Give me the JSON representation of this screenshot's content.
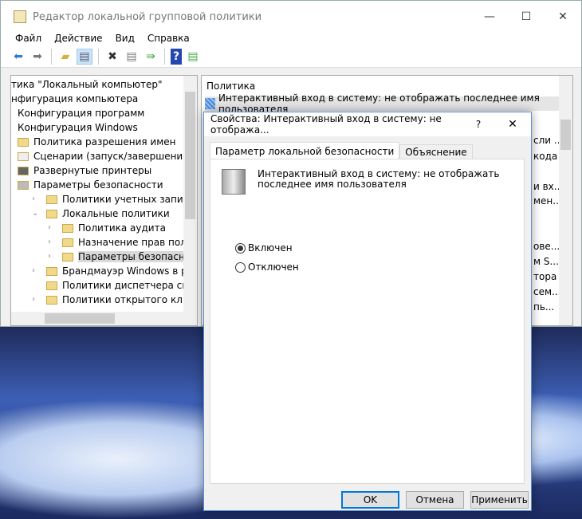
{
  "window": {
    "title": "Редактор локальной групповой политики",
    "minimize": "—",
    "maximize": "☐",
    "close": "✕"
  },
  "menu": [
    "Файл",
    "Действие",
    "Вид",
    "Справка"
  ],
  "toolbar": [
    "back-icon",
    "forward-icon",
    "up-folder-icon",
    "show-hide-tree-icon",
    "delete-icon",
    "properties-icon",
    "export-icon",
    "help-icon",
    "show-action-pane-icon"
  ],
  "tree": [
    {
      "label": "тика \"Локальный компьютер\"",
      "indent": 0
    },
    {
      "label": "нфигурация компьютера",
      "indent": 0
    },
    {
      "label": "Конфигурация программ",
      "indent": 1
    },
    {
      "label": "Конфигурация Windows",
      "indent": 1
    },
    {
      "label": "Политика разрешения имен",
      "indent": 2,
      "icon": "folder"
    },
    {
      "label": "Сценарии (запуск/завершение)",
      "indent": 2,
      "icon": "script"
    },
    {
      "label": "Развернутые принтеры",
      "indent": 2,
      "icon": "printer"
    },
    {
      "label": "Параметры безопасности",
      "indent": 2,
      "icon": "security"
    },
    {
      "label": "Политики учетных записей",
      "indent": 3,
      "icon": "folder",
      "chevron": ">"
    },
    {
      "label": "Локальные политики",
      "indent": 3,
      "icon": "folder",
      "chevron": "v"
    },
    {
      "label": "Политика аудита",
      "indent": 4,
      "icon": "folder",
      "chevron": ">"
    },
    {
      "label": "Назначение прав пользоват",
      "indent": 4,
      "icon": "folder",
      "chevron": ">"
    },
    {
      "label": "Параметры безопасности",
      "indent": 4,
      "icon": "folder",
      "chevron": ">",
      "selected": true
    },
    {
      "label": "Брандмауэр Windows в режим",
      "indent": 3,
      "icon": "folder",
      "chevron": ">"
    },
    {
      "label": "Политики диспетчера списка с",
      "indent": 3,
      "icon": "folder"
    },
    {
      "label": "Политики открытого ключа",
      "indent": 3,
      "icon": "folder",
      "chevron": ">"
    }
  ],
  "right": {
    "header": "Политика",
    "selected_row": "Интерактивный вход в систему: не отображать последнее имя пользователя",
    "fragments": [
      "сли ..",
      "кода",
      "и вх...",
      "мен...",
      "ове...",
      "м S...",
      "тора",
      "сем...",
      "пь..."
    ]
  },
  "dialog": {
    "title": "Свойства: Интерактивный вход в систему: не отобража...",
    "help": "?",
    "close": "✕",
    "tabs": [
      "Параметр локальной безопасности",
      "Объяснение"
    ],
    "description": "Интерактивный вход в систему: не отображать последнее имя пользователя",
    "options": [
      {
        "label": "Включен",
        "checked": true
      },
      {
        "label": "Отключен",
        "checked": false
      }
    ],
    "buttons": {
      "ok": "OK",
      "cancel": "Отмена",
      "apply": "Применить"
    }
  }
}
